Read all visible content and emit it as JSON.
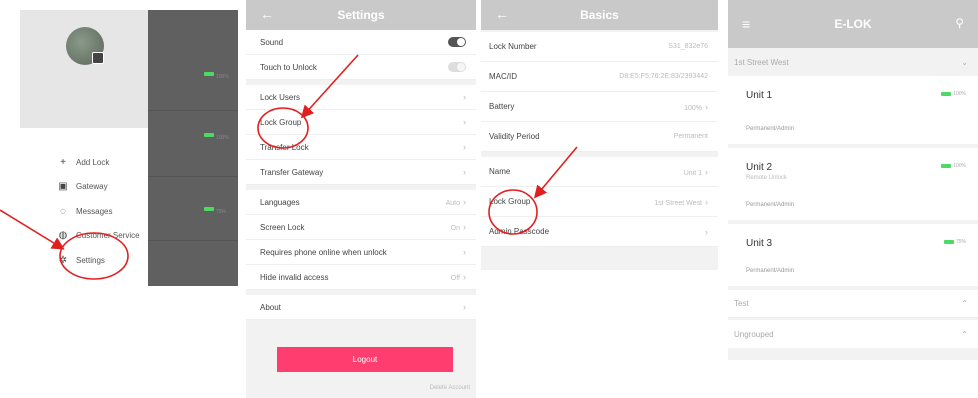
{
  "colors": {
    "accent": "#ff3d6e",
    "header": "#c9c9c9",
    "battery": "#4cd964",
    "annotation": "#e02020"
  },
  "drawer": {
    "menu": [
      {
        "icon": "plus-icon",
        "glyph": "+",
        "label": "Add Lock"
      },
      {
        "icon": "gateway-icon",
        "glyph": "▣",
        "label": "Gateway"
      },
      {
        "icon": "message-icon",
        "glyph": "◌",
        "label": "Messages"
      },
      {
        "icon": "customer-service-icon",
        "glyph": "◍",
        "label": "Customer Service"
      },
      {
        "icon": "gear-icon",
        "glyph": "✲",
        "label": "Settings"
      }
    ],
    "battery_text": [
      "100%",
      "100%",
      "75%"
    ]
  },
  "settings": {
    "title": "Settings",
    "rows": [
      {
        "label": "Sound"
      },
      {
        "label": "Touch to Unlock"
      },
      {
        "label": "Lock Users"
      },
      {
        "label": "Lock Group"
      },
      {
        "label": "Transfer Lock"
      },
      {
        "label": "Transfer Gateway"
      },
      {
        "label": "Languages",
        "value": "Auto"
      },
      {
        "label": "Screen Lock",
        "value": "On"
      },
      {
        "label": "Requires phone online when unlock"
      },
      {
        "label": "Hide invalid access",
        "value": "Off"
      },
      {
        "label": "About"
      }
    ],
    "logout": "Logout",
    "delete_account": "Delete Account"
  },
  "basics": {
    "title": "Basics",
    "rows": [
      {
        "label": "Lock Number",
        "value": "S31_832e76"
      },
      {
        "label": "MAC/ID",
        "value": "D8:E5:F5:76:2E:83/2393442"
      },
      {
        "label": "Battery",
        "value": "100%"
      },
      {
        "label": "Validity Period",
        "value": "Permanent"
      },
      {
        "label": "Name",
        "value": "Unit 1"
      },
      {
        "label": "Lock Group",
        "value": "1st Street West"
      },
      {
        "label": "Admin Passcode",
        "value": ""
      }
    ]
  },
  "elok": {
    "title": "E-LOK",
    "group1": "1st Street West",
    "units": [
      {
        "name": "Unit 1",
        "sub": "",
        "perm": "Permanent/Admin",
        "battery": "100%"
      },
      {
        "name": "Unit 2",
        "sub": "Remote Unlock",
        "perm": "Permanent/Admin",
        "battery": "100%"
      },
      {
        "name": "Unit 3",
        "sub": "",
        "perm": "Permanent/Admin",
        "battery": "75%"
      }
    ],
    "group2": "Test",
    "group3": "Ungrouped"
  }
}
